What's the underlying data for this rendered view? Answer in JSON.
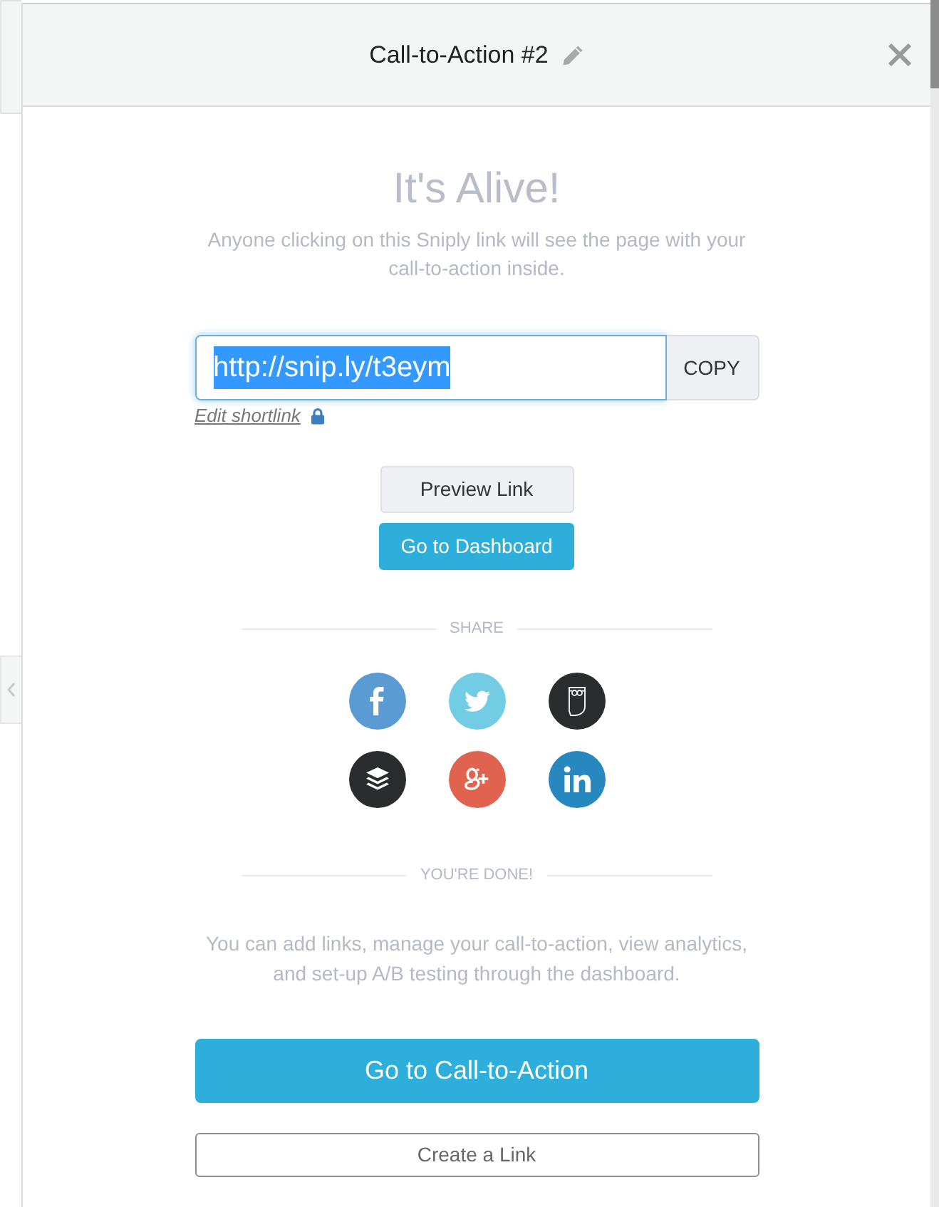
{
  "header": {
    "title": "Call-to-Action #2"
  },
  "confirmation": {
    "heading": "It's Alive!",
    "message": "Anyone clicking on this Sniply link will see the page with your call-to-action inside."
  },
  "shortlink": {
    "value": "http://snip.ly/t3eym",
    "focused": true,
    "text_selected": true,
    "copy_label": "COPY",
    "edit_label": "Edit shortlink",
    "locked": true
  },
  "buttons": [
    {
      "label": "Preview Link",
      "kind": "secondary"
    },
    {
      "label": "Go to Dashboard",
      "kind": "primary"
    }
  ],
  "share": {
    "label": "SHARE",
    "networks": [
      {
        "kind": "facebook",
        "color": "#5b9bd3"
      },
      {
        "kind": "twitter",
        "color": "#72cce4"
      },
      {
        "kind": "owl",
        "color": "#2b2c2e"
      },
      {
        "kind": "layers",
        "color": "#2b2c2e"
      },
      {
        "kind": "google-plus",
        "color": "#e0634f"
      },
      {
        "kind": "linkedin",
        "color": "#2788c0"
      }
    ]
  },
  "done": {
    "label": "YOU'RE DONE!",
    "message": "You can add links, manage your call-to-action, view analytics, and set-up A/B testing through the dashboard."
  },
  "actions": [
    {
      "label": "Go to Call-to-Action",
      "kind": "primary"
    },
    {
      "label": "Create a Link",
      "kind": "outline"
    }
  ]
}
